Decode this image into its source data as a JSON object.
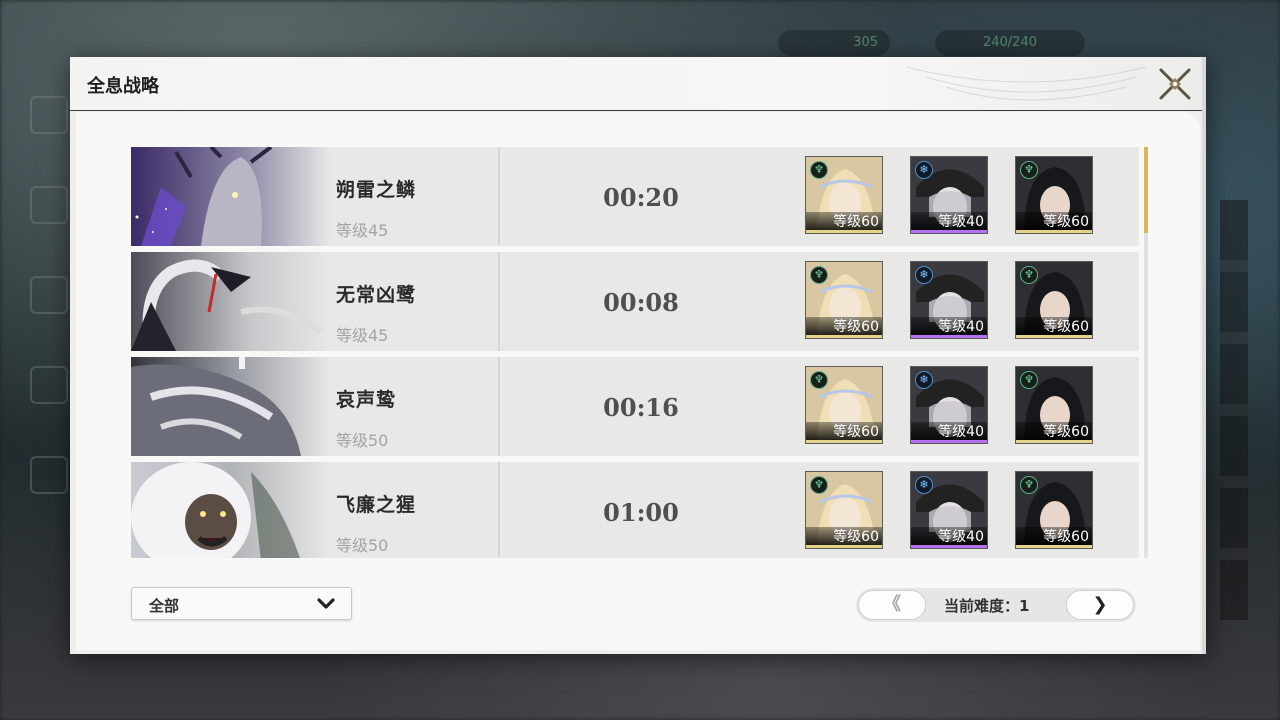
{
  "background_hud": {
    "currency_1": "305",
    "stamina": "240/240"
  },
  "modal": {
    "title": "全息战略"
  },
  "records": [
    {
      "boss_name": "朔雷之鳞",
      "boss_level": "等级45",
      "clear_time": "00:20",
      "team": [
        {
          "element": "aero",
          "level": "等级60",
          "rarity": "gold"
        },
        {
          "element": "glacio",
          "level": "等级40",
          "rarity": "purple"
        },
        {
          "element": "aero",
          "level": "等级60",
          "rarity": "gold"
        }
      ]
    },
    {
      "boss_name": "无常凶鹭",
      "boss_level": "等级45",
      "clear_time": "00:08",
      "team": [
        {
          "element": "aero",
          "level": "等级60",
          "rarity": "gold"
        },
        {
          "element": "glacio",
          "level": "等级40",
          "rarity": "purple"
        },
        {
          "element": "aero",
          "level": "等级60",
          "rarity": "gold"
        }
      ]
    },
    {
      "boss_name": "哀声鸷",
      "boss_level": "等级50",
      "clear_time": "00:16",
      "team": [
        {
          "element": "aero",
          "level": "等级60",
          "rarity": "gold"
        },
        {
          "element": "glacio",
          "level": "等级40",
          "rarity": "purple"
        },
        {
          "element": "aero",
          "level": "等级60",
          "rarity": "gold"
        }
      ]
    },
    {
      "boss_name": "飞廉之猩",
      "boss_level": "等级50",
      "clear_time": "01:00",
      "team": [
        {
          "element": "aero",
          "level": "等级60",
          "rarity": "gold"
        },
        {
          "element": "glacio",
          "level": "等级40",
          "rarity": "purple"
        },
        {
          "element": "aero",
          "level": "等级60",
          "rarity": "gold"
        }
      ]
    }
  ],
  "filter": {
    "selected": "全部"
  },
  "pager": {
    "prev_label": "《",
    "next_label": "❯",
    "difficulty_text": "当前难度：1"
  },
  "colors": {
    "panel_bg": "#eeeeec",
    "row_bg": "#e8e8e6",
    "gold_rarity": "#e4d38a",
    "purple_rarity": "#b472f0",
    "scroll_thumb": "#d8b65a"
  }
}
